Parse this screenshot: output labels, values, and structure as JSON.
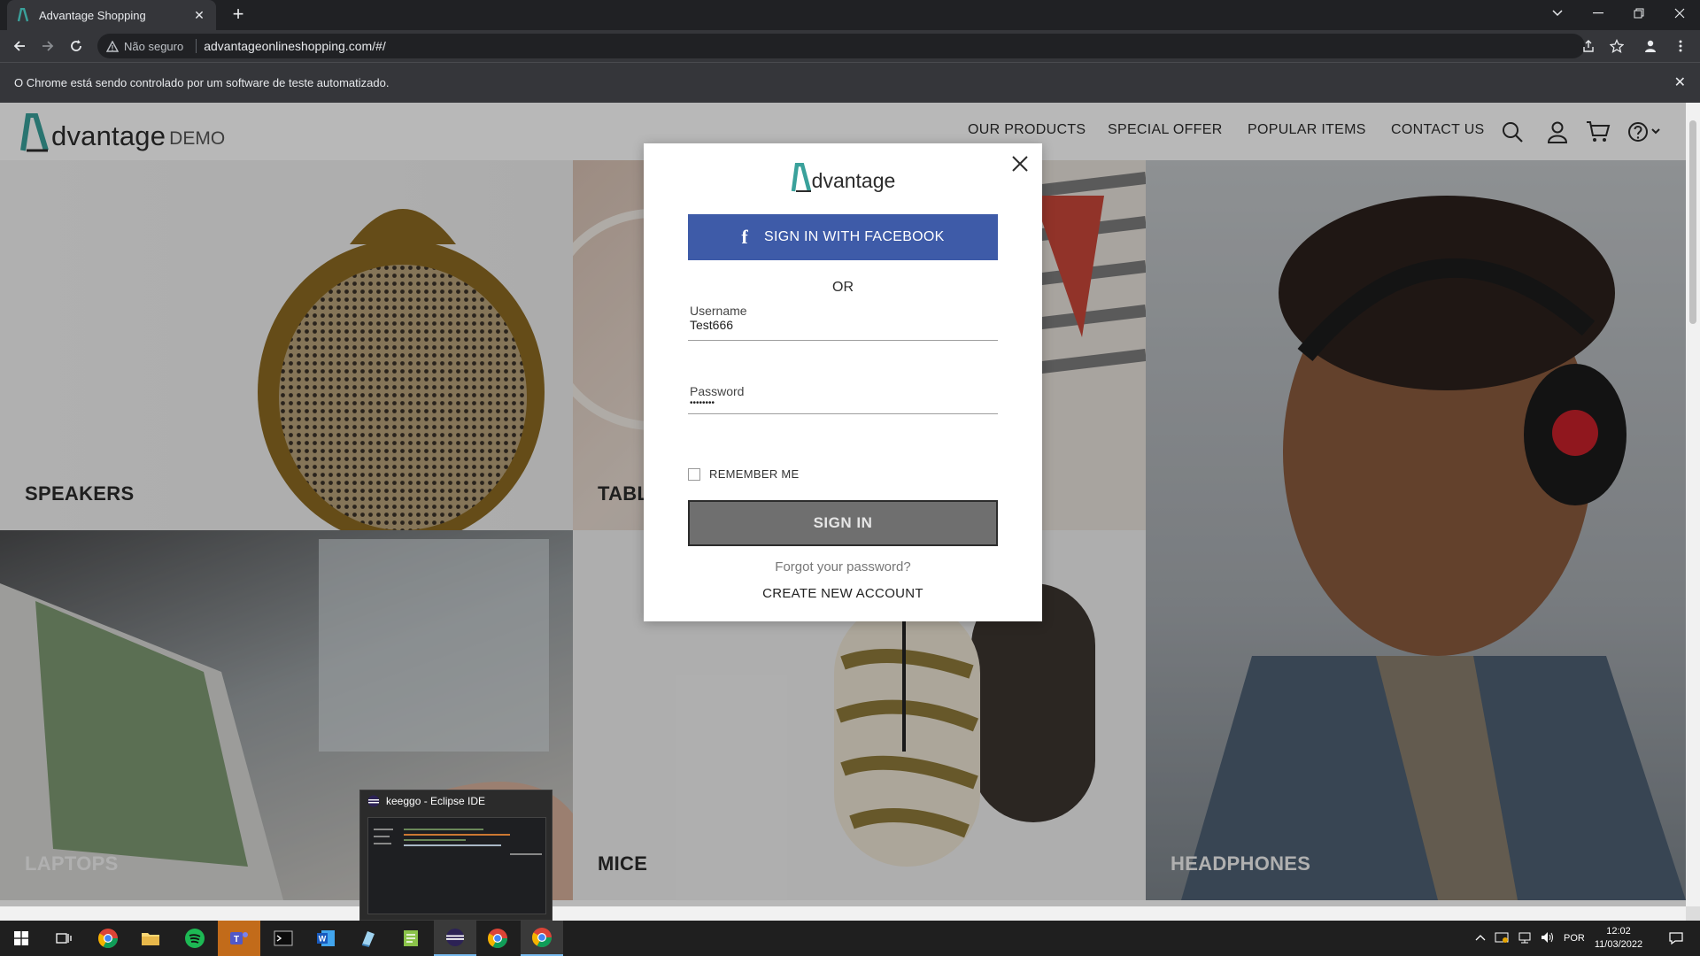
{
  "browser": {
    "tab_title": "Advantage Shopping",
    "new_tab": "+",
    "security_label": "Não seguro",
    "url": "advantageonlineshopping.com/#/",
    "automation_notice": "O Chrome está sendo controlado por um software de teste automatizado."
  },
  "site": {
    "logo_word": "dvantage",
    "logo_demo": "DEMO",
    "nav": [
      "OUR PRODUCTS",
      "SPECIAL OFFER",
      "POPULAR ITEMS",
      "CONTACT US"
    ],
    "categories": {
      "speakers": "SPEAKERS",
      "tablets": "TABL",
      "laptops": "LAPTOPS",
      "mice": "MICE",
      "headphones": "HEADPHONES"
    }
  },
  "login": {
    "logo_word": "dvantage",
    "facebook_button": "SIGN IN WITH FACEBOOK",
    "or_text": "OR",
    "username_label": "Username",
    "username_value": "Test666",
    "password_label": "Password",
    "password_value": "••••••••",
    "remember_label": "REMEMBER ME",
    "remember_checked": false,
    "signin_button": "SIGN IN",
    "forgot_link": "Forgot your password?",
    "create_link": "CREATE NEW ACCOUNT"
  },
  "taskbar_preview": {
    "title": "keeggo - Eclipse IDE"
  },
  "tray": {
    "language": "POR",
    "time": "12:02",
    "date": "11/03/2022"
  },
  "colors": {
    "brand_teal": "#3aa19b",
    "facebook_blue": "#3e5ba8",
    "signin_gray": "#6f6f6f"
  }
}
